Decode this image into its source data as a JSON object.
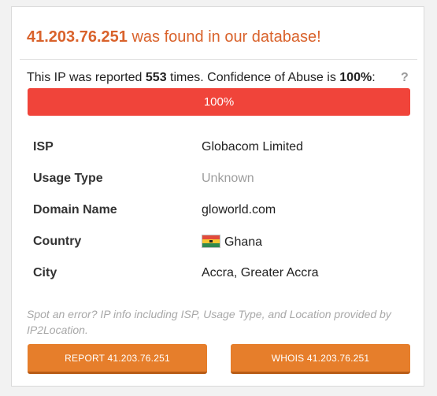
{
  "header": {
    "ip": "41.203.76.251",
    "found_text": " was found in our database!"
  },
  "report": {
    "prefix": "This IP was reported ",
    "count": "553",
    "middle": " times. Confidence of Abuse is ",
    "confidence": "100%",
    "suffix": ":",
    "help": "?"
  },
  "confidence_bar": {
    "label": "100%",
    "percent": 100,
    "color": "#f0443a"
  },
  "details": [
    {
      "key": "ISP",
      "value": "Globacom Limited"
    },
    {
      "key": "Usage Type",
      "value": "Unknown"
    },
    {
      "key": "Domain Name",
      "value": "gloworld.com"
    },
    {
      "key": "Country",
      "value": "Ghana",
      "icon": "ghana-flag-icon"
    },
    {
      "key": "City",
      "value": "Accra, Greater Accra"
    }
  ],
  "note": "Spot an error? IP info including ISP, Usage Type, and Location provided by IP2Location.",
  "buttons": {
    "report": "REPORT 41.203.76.251",
    "whois": "WHOIS 41.203.76.251"
  },
  "colors": {
    "accent": "#d9622b",
    "button": "#e67e2b",
    "bar": "#f0443a"
  }
}
